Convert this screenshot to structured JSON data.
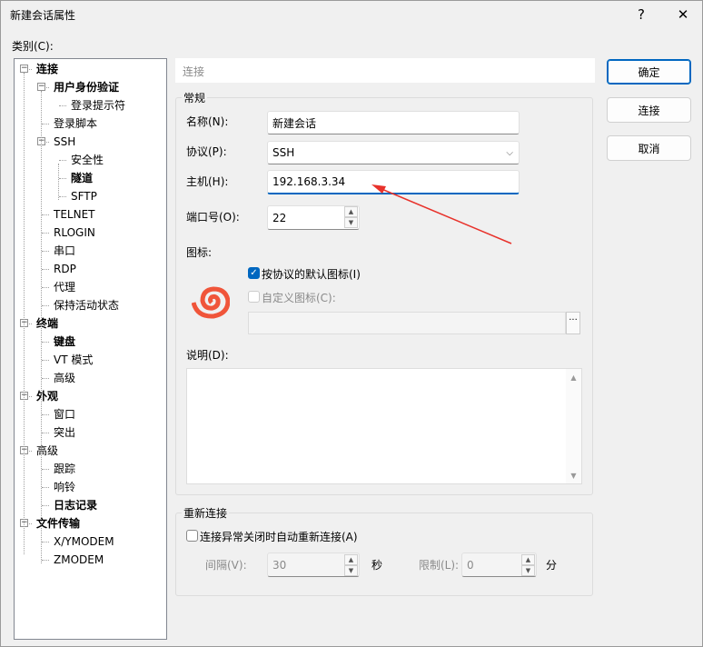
{
  "window": {
    "title": "新建会话属性",
    "help": "?",
    "close": "✕"
  },
  "category_label": "类别(C):",
  "tree": [
    {
      "label": "连接",
      "level": 0,
      "bold": true,
      "expander": "−"
    },
    {
      "label": "用户身份验证",
      "level": 1,
      "bold": true,
      "expander": "−"
    },
    {
      "label": "登录提示符",
      "level": 2,
      "bold": false
    },
    {
      "label": "登录脚本",
      "level": 1,
      "bold": false
    },
    {
      "label": "SSH",
      "level": 1,
      "bold": false,
      "expander": "−"
    },
    {
      "label": "安全性",
      "level": 2,
      "bold": false
    },
    {
      "label": "隧道",
      "level": 2,
      "bold": true
    },
    {
      "label": "SFTP",
      "level": 2,
      "bold": false
    },
    {
      "label": "TELNET",
      "level": 1,
      "bold": false
    },
    {
      "label": "RLOGIN",
      "level": 1,
      "bold": false
    },
    {
      "label": "串口",
      "level": 1,
      "bold": false
    },
    {
      "label": "RDP",
      "level": 1,
      "bold": false
    },
    {
      "label": "代理",
      "level": 1,
      "bold": false
    },
    {
      "label": "保持活动状态",
      "level": 1,
      "bold": false
    },
    {
      "label": "终端",
      "level": 0,
      "bold": true,
      "expander": "−"
    },
    {
      "label": "键盘",
      "level": 1,
      "bold": true
    },
    {
      "label": "VT 模式",
      "level": 1,
      "bold": false
    },
    {
      "label": "高级",
      "level": 1,
      "bold": false
    },
    {
      "label": "外观",
      "level": 0,
      "bold": true,
      "expander": "−"
    },
    {
      "label": "窗口",
      "level": 1,
      "bold": false
    },
    {
      "label": "突出",
      "level": 1,
      "bold": false
    },
    {
      "label": "高级",
      "level": 0,
      "bold": false,
      "expander": "−"
    },
    {
      "label": "跟踪",
      "level": 1,
      "bold": false
    },
    {
      "label": "响铃",
      "level": 1,
      "bold": false
    },
    {
      "label": "日志记录",
      "level": 1,
      "bold": true
    },
    {
      "label": "文件传输",
      "level": 0,
      "bold": true,
      "expander": "−"
    },
    {
      "label": "X/YMODEM",
      "level": 1,
      "bold": false
    },
    {
      "label": "ZMODEM",
      "level": 1,
      "bold": false
    }
  ],
  "header": "连接",
  "general": {
    "label": "常规",
    "name_label": "名称(N):",
    "name_value": "新建会话",
    "protocol_label": "协议(P):",
    "protocol_value": "SSH",
    "host_label": "主机(H):",
    "host_value": "192.168.3.34",
    "port_label": "端口号(O):",
    "port_value": "22"
  },
  "icon": {
    "label": "图标:",
    "default_icon": "按协议的默认图标(I)",
    "default_checked": true,
    "custom_icon": "自定义图标(C):",
    "custom_checked": false,
    "browse": "..."
  },
  "description_label": "说明(D):",
  "reconnect": {
    "label": "重新连接",
    "checkbox": "连接异常关闭时自动重新连接(A)",
    "interval_label": "间隔(V):",
    "interval_value": "30",
    "sec": "秒",
    "limit_label": "限制(L):",
    "limit_value": "0",
    "min": "分"
  },
  "buttons": {
    "ok": "确定",
    "connect": "连接",
    "cancel": "取消"
  },
  "colors": {
    "accent": "#0067c0",
    "arrow": "#e8322b",
    "icon": "#f0553a"
  }
}
